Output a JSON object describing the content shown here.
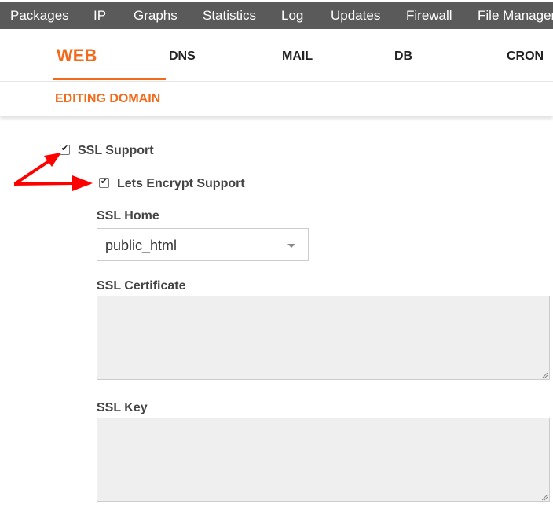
{
  "topnav": {
    "items": [
      "Packages",
      "IP",
      "Graphs",
      "Statistics",
      "Log",
      "Updates",
      "Firewall",
      "File Manager"
    ]
  },
  "tabs": [
    "WEB",
    "DNS",
    "MAIL",
    "DB",
    "CRON"
  ],
  "subheader": {
    "title": "EDITING DOMAIN"
  },
  "form": {
    "ssl_support": {
      "label": "SSL Support",
      "checked": true
    },
    "lets_encrypt": {
      "label": "Lets Encrypt Support",
      "checked": true
    },
    "ssl_home": {
      "label": "SSL Home",
      "value": "public_html"
    },
    "ssl_certificate": {
      "label": "SSL Certificate",
      "value": ""
    },
    "ssl_key": {
      "label": "SSL Key",
      "value": ""
    }
  },
  "colors": {
    "accent": "#f26a1b",
    "topbar": "#5a5a5a",
    "annotation_arrow": "#ff0000"
  }
}
